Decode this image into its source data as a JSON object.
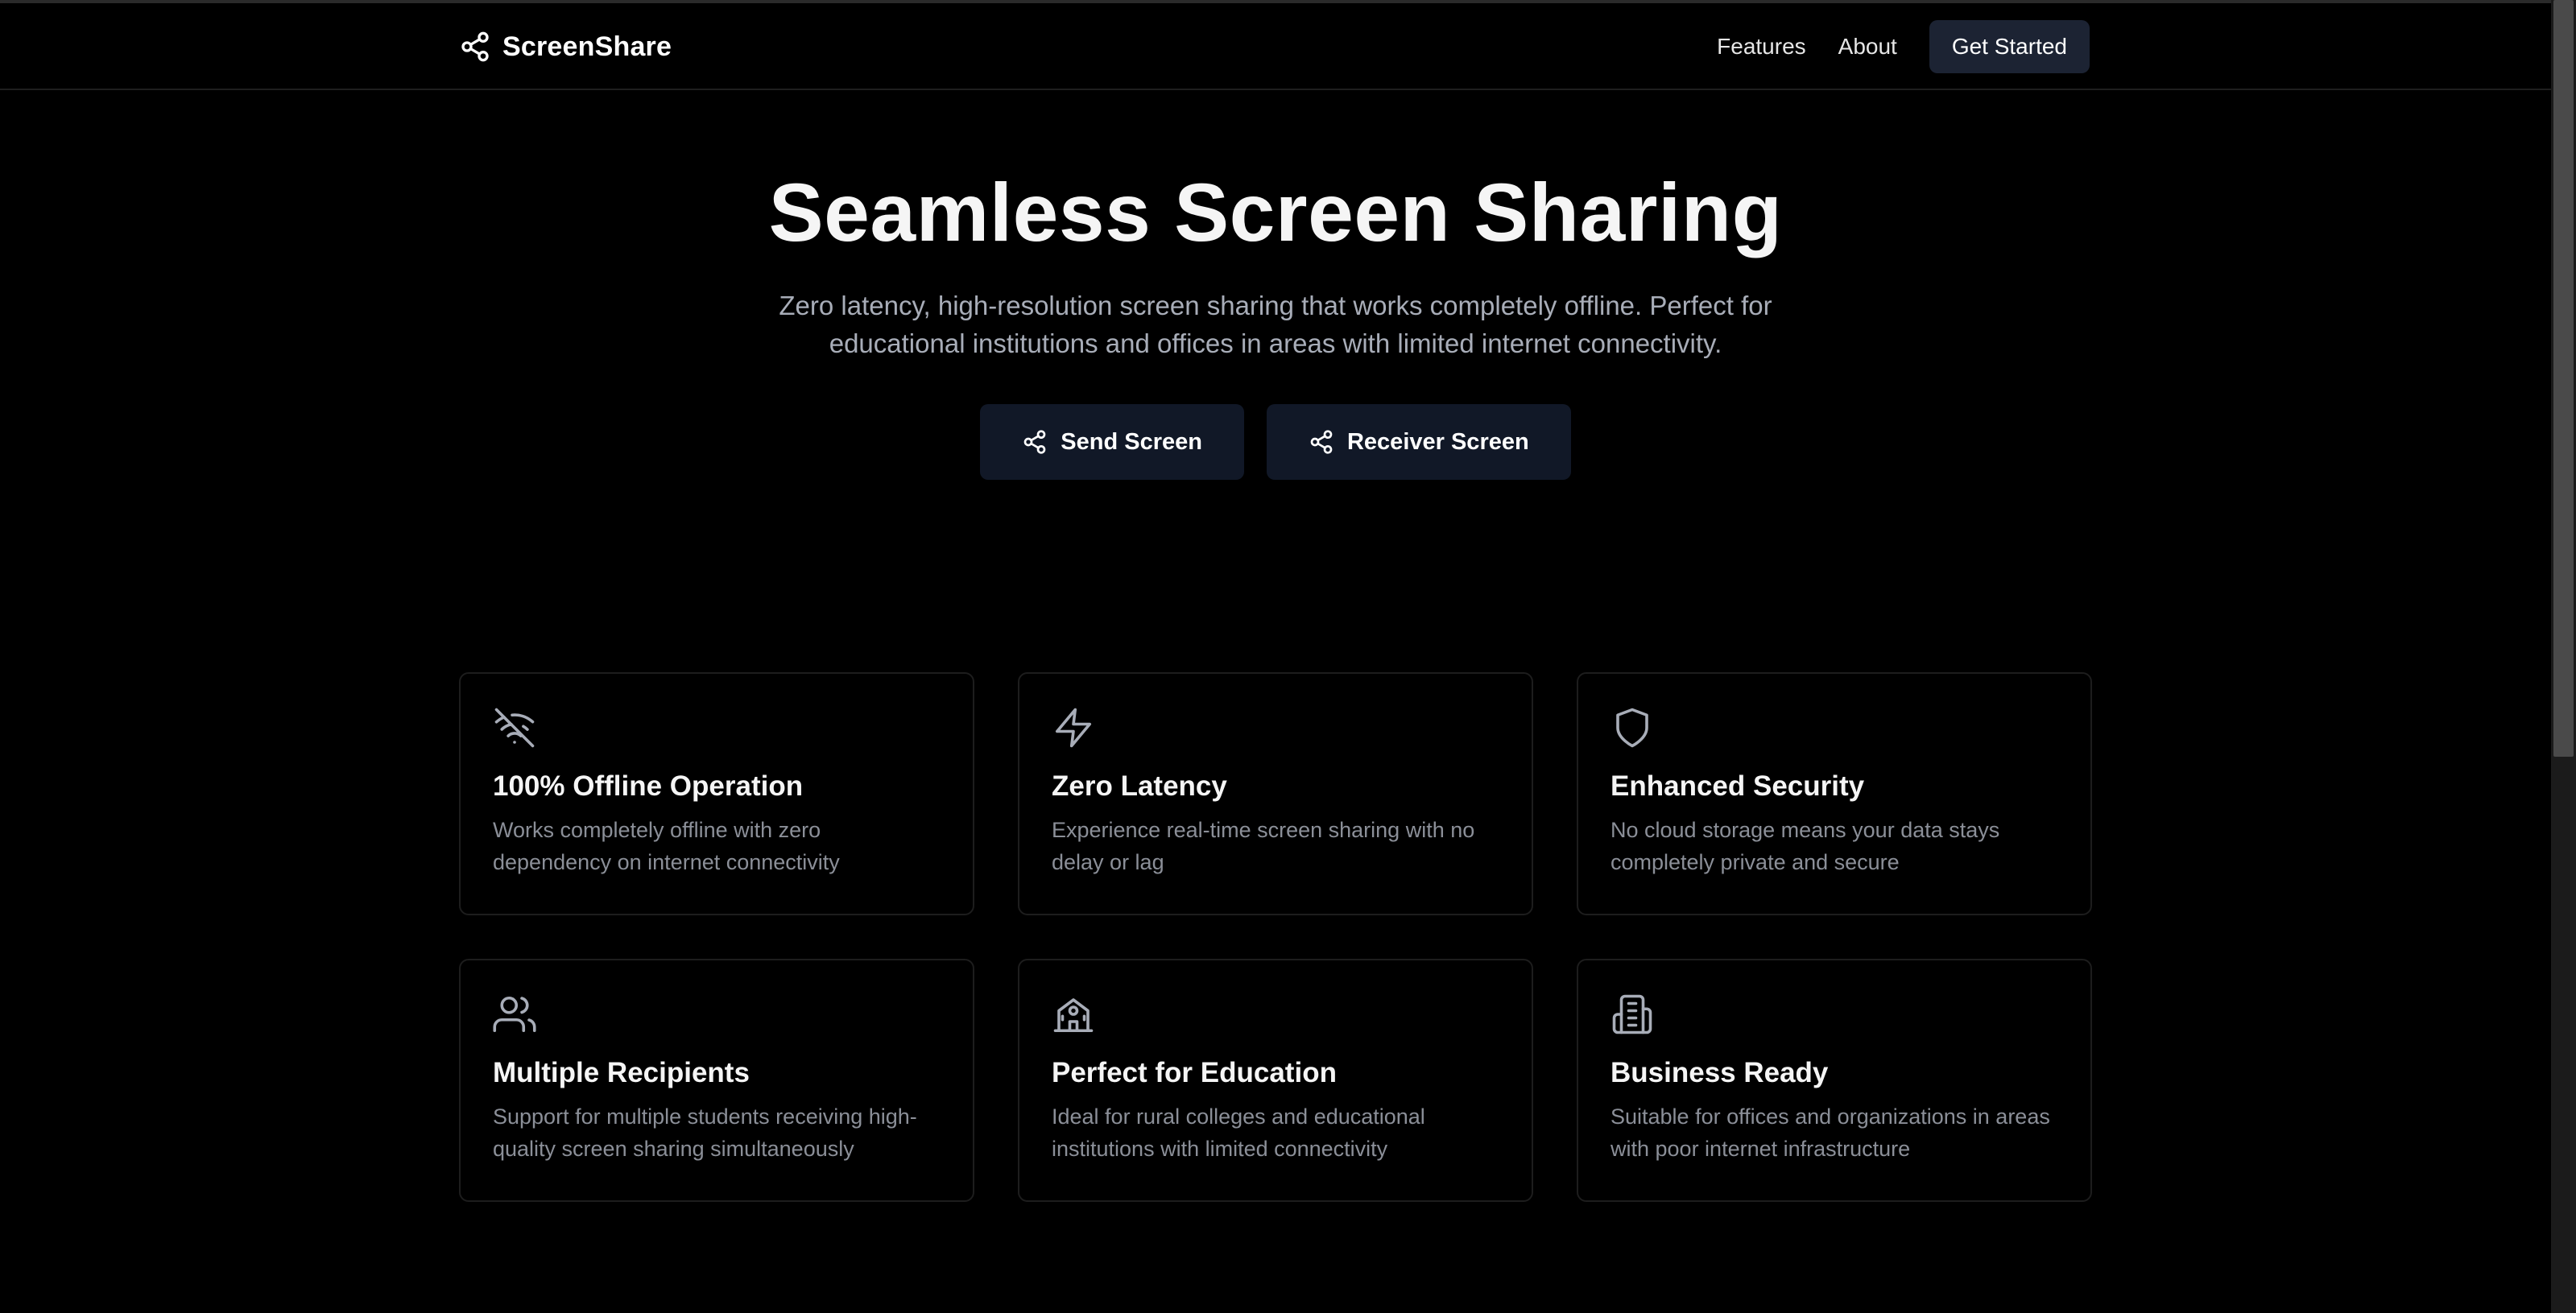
{
  "brand": {
    "name": "ScreenShare",
    "icon": "share-icon"
  },
  "nav": {
    "features_label": "Features",
    "about_label": "About",
    "get_started_label": "Get Started"
  },
  "hero": {
    "title": "Seamless Screen Sharing",
    "subtitle": "Zero latency, high-resolution screen sharing that works completely offline. Perfect for educational institutions and offices in areas with limited internet connectivity.",
    "send_label": "Send Screen",
    "receive_label": "Receiver Screen"
  },
  "features": [
    {
      "icon": "wifi-off-icon",
      "title": "100% Offline Operation",
      "description": "Works completely offline with zero dependency on internet connectivity"
    },
    {
      "icon": "zap-icon",
      "title": "Zero Latency",
      "description": "Experience real-time screen sharing with no delay or lag"
    },
    {
      "icon": "shield-icon",
      "title": "Enhanced Security",
      "description": "No cloud storage means your data stays completely private and secure"
    },
    {
      "icon": "users-icon",
      "title": "Multiple Recipients",
      "description": "Support for multiple students receiving high-quality screen sharing simultaneously"
    },
    {
      "icon": "school-icon",
      "title": "Perfect for Education",
      "description": "Ideal for rural colleges and educational institutions with limited connectivity"
    },
    {
      "icon": "building-icon",
      "title": "Business Ready",
      "description": "Suitable for offices and organizations in areas with poor internet infrastructure"
    }
  ],
  "colors": {
    "background": "#000000",
    "button_bg": "#111827",
    "header_button_bg": "#1c2333",
    "muted_text": "#8b8f98"
  }
}
